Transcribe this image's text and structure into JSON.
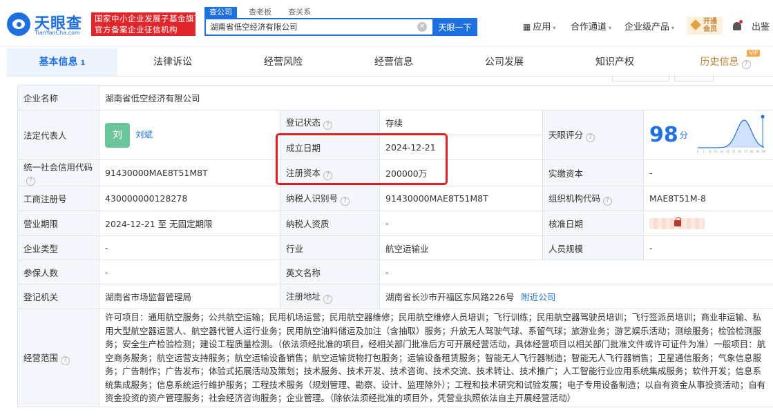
{
  "header": {
    "logo_cn": "天眼查",
    "logo_en": "TianYanCha.com",
    "badge_line1": "国家中小企业发展子基金旗下",
    "badge_line2": "官方备案企业征信机构",
    "search_tabs": [
      "查公司",
      "查老板",
      "查关系"
    ],
    "search_value": "湖南省低空经济有限公司",
    "search_button": "天眼一下",
    "nav": [
      {
        "label": "应用",
        "caret": "▾"
      },
      {
        "label": "合作通道",
        "caret": "▾"
      },
      {
        "label": "企业级产品",
        "caret": "▾"
      }
    ],
    "vip_line1": "开通",
    "vip_line2": "会员",
    "logout": "出鉴"
  },
  "tabs": [
    {
      "label": "基本信息",
      "count": "1"
    },
    {
      "label": "法律诉讼"
    },
    {
      "label": "经营风险"
    },
    {
      "label": "经营信息"
    },
    {
      "label": "公司发展"
    },
    {
      "label": "知识产权"
    },
    {
      "label": "历史信息",
      "tag": "VIP"
    }
  ],
  "info": {
    "company_name_label": "企业名称",
    "company_name": "湖南省低空经济有限公司",
    "legal_rep_label": "法定代表人",
    "legal_rep_avatar": "刘",
    "legal_rep": "刘斌",
    "status_label": "登记状态",
    "status": "存续",
    "established_label": "成立日期",
    "established": "2024-12-21",
    "capital_label": "注册资本",
    "capital": "200000万",
    "score_label": "天眼评分",
    "score": "98",
    "score_unit": "分",
    "score_distribution": {
      "x_ticks": [
        "0",
        "1",
        "11",
        "21",
        "31",
        "41",
        "51",
        "61",
        "71",
        "81",
        "91",
        "100"
      ]
    },
    "credit_code_label": "统一社会信用代码",
    "credit_code": "91430000MAE8T51M8T",
    "paid_capital_label": "实缴资本",
    "paid_capital": "-",
    "reg_no_label": "工商注册号",
    "reg_no": "430000000128278",
    "taxpayer_id_label": "纳税人识别号",
    "taxpayer_id": "91430000MAE8T51M8T",
    "org_code_label": "组织机构代码",
    "org_code": "MAE8T51M-8",
    "term_label": "营业期限",
    "term": "2024-12-21 至 无固定期限",
    "taxpayer_qual_label": "纳税人资质",
    "taxpayer_qual": "-",
    "approval_date_label": "核准日期",
    "type_label": "企业类型",
    "type": "-",
    "industry_label": "行业",
    "industry": "航空运输业",
    "staff_size_label": "人员规模",
    "staff_size": "-",
    "insured_label": "参保人数",
    "insured": "-",
    "english_name_label": "英文名称",
    "english_name": "-",
    "authority_label": "登记机关",
    "authority": "湖南省市场监督管理局",
    "address_label": "注册地址",
    "address": "湖南省长沙市开福区东风路226号",
    "nearby_link": "附近公司",
    "scope_label": "经营范围",
    "scope": "许可项目：通用航空服务；公共航空运输；民用机场运营；民用航空器维修；民用航空维修人员培训；飞行训练；民用航空器驾驶员培训；飞行签派员培训；商业非运输、私用大型航空器运营人、航空器代管人运行业务；民用航空油料储运及加注（含抽取）服务；升放无人驾驶气球、系留气球；旅游业务；游艺娱乐活动；测绘服务；检验检测服务；安全生产检验检测；建设工程质量检测。（依法须经批准的项目，经相关部门批准后方可开展经营活动，具体经营项目以相关部门批准文件或许可证件为准）一般项目：航空商务服务；航空运营支持服务；航空运输设备销售；航空运输货物打包服务；运输设备租赁服务；智能无人飞行器制造；智能无人飞行器销售；卫星通信服务；气象信息服务；广告制作；广告发布；体验式拓展活动及策划；技术服务、技术开发、技术咨询、技术交流、技术转让、技术推广；人工智能行业应用系统集成服务；软件开发；信息系统集成服务；信息系统运行维护服务；工程技术服务（规划管理、勘察、设计、监理除外）；工程和技术研究和试验发展；电子专用设备制造；以自有资金从事投资活动；自有资金投资的资产管理服务；社会经济咨询服务；企业管理。（除依法须经批准的项目外，凭营业执照依法自主开展经营活动）"
  },
  "colors": {
    "accent": "#1e6fe0",
    "badge_red": "#e0262b",
    "status_green": "#2aa15b",
    "highlight_red": "#e02020"
  }
}
